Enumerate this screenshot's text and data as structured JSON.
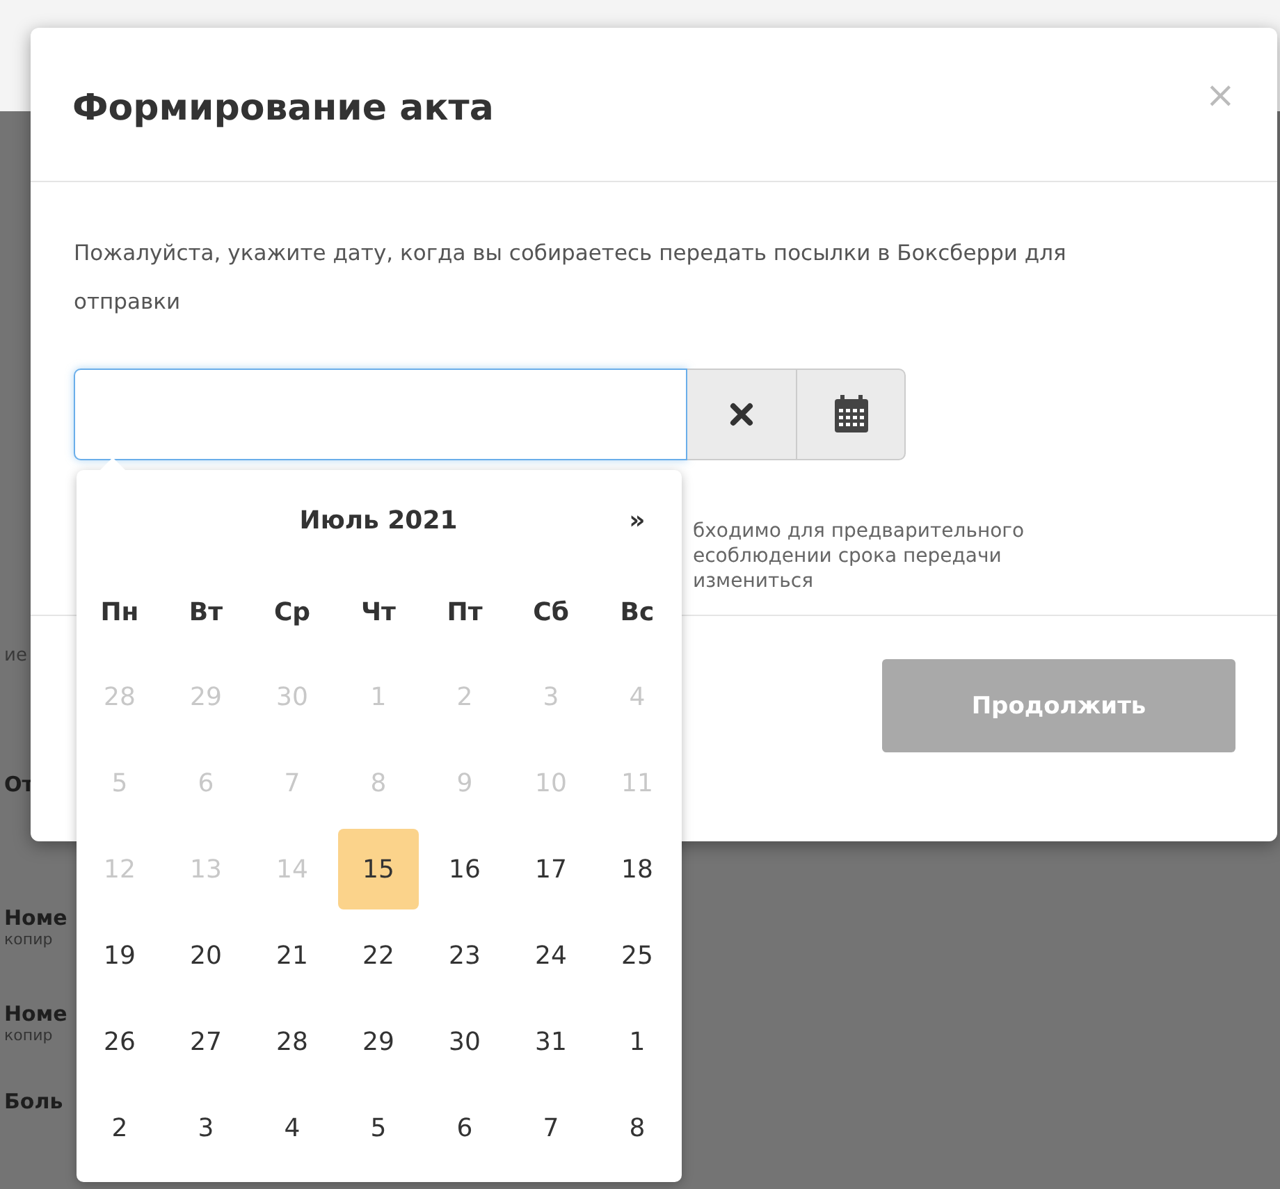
{
  "background_page": {
    "items": [
      {
        "kind": "small",
        "text": "ие"
      },
      {
        "kind": "bold",
        "text": "От"
      },
      {
        "kind": "bold",
        "text": "Номе"
      },
      {
        "kind": "small",
        "text": "копир"
      },
      {
        "kind": "bold",
        "text": "Номе"
      },
      {
        "kind": "small",
        "text": "копир"
      },
      {
        "kind": "bold",
        "text": "Боль"
      }
    ]
  },
  "dialog": {
    "title": "Формирование акта",
    "close": "×",
    "message": "Пожалуйста, укажите дату, когда вы собираетесь передать посылки в Боксберри для отправки",
    "note_lines": [
      "бходимо для предварительного",
      "есоблюдении срока передачи",
      "измениться"
    ],
    "continue_button": {
      "label": "Продолжить",
      "disabled": true
    }
  },
  "datepicker": {
    "month": "Июль 2021",
    "next": "»",
    "weekdays": [
      "Пн",
      "Вт",
      "Ср",
      "Чт",
      "Пт",
      "Сб",
      "Вс"
    ],
    "weeks": [
      [
        {
          "day": "28",
          "disabled": true,
          "selected": false
        },
        {
          "day": "29",
          "disabled": true,
          "selected": false
        },
        {
          "day": "30",
          "disabled": true,
          "selected": false
        },
        {
          "day": "1",
          "disabled": true,
          "selected": false
        },
        {
          "day": "2",
          "disabled": true,
          "selected": false
        },
        {
          "day": "3",
          "disabled": true,
          "selected": false
        },
        {
          "day": "4",
          "disabled": true,
          "selected": false
        }
      ],
      [
        {
          "day": "5",
          "disabled": true,
          "selected": false
        },
        {
          "day": "6",
          "disabled": true,
          "selected": false
        },
        {
          "day": "7",
          "disabled": true,
          "selected": false
        },
        {
          "day": "8",
          "disabled": true,
          "selected": false
        },
        {
          "day": "9",
          "disabled": true,
          "selected": false
        },
        {
          "day": "10",
          "disabled": true,
          "selected": false
        },
        {
          "day": "11",
          "disabled": true,
          "selected": false
        }
      ],
      [
        {
          "day": "12",
          "disabled": true,
          "selected": false
        },
        {
          "day": "13",
          "disabled": true,
          "selected": false
        },
        {
          "day": "14",
          "disabled": true,
          "selected": false
        },
        {
          "day": "15",
          "disabled": false,
          "selected": true
        },
        {
          "day": "16",
          "disabled": false,
          "selected": false
        },
        {
          "day": "17",
          "disabled": false,
          "selected": false
        },
        {
          "day": "18",
          "disabled": false,
          "selected": false
        }
      ],
      [
        {
          "day": "19",
          "disabled": false,
          "selected": false
        },
        {
          "day": "20",
          "disabled": false,
          "selected": false
        },
        {
          "day": "21",
          "disabled": false,
          "selected": false
        },
        {
          "day": "22",
          "disabled": false,
          "selected": false
        },
        {
          "day": "23",
          "disabled": false,
          "selected": false
        },
        {
          "day": "24",
          "disabled": false,
          "selected": false
        },
        {
          "day": "25",
          "disabled": false,
          "selected": false
        }
      ],
      [
        {
          "day": "26",
          "disabled": false,
          "selected": false
        },
        {
          "day": "27",
          "disabled": false,
          "selected": false
        },
        {
          "day": "28",
          "disabled": false,
          "selected": false
        },
        {
          "day": "29",
          "disabled": false,
          "selected": false
        },
        {
          "day": "30",
          "disabled": false,
          "selected": false
        },
        {
          "day": "31",
          "disabled": false,
          "selected": false
        },
        {
          "day": "1",
          "disabled": false,
          "selected": false
        }
      ],
      [
        {
          "day": "2",
          "disabled": false,
          "selected": false
        },
        {
          "day": "3",
          "disabled": false,
          "selected": false
        },
        {
          "day": "4",
          "disabled": false,
          "selected": false
        },
        {
          "day": "5",
          "disabled": false,
          "selected": false
        },
        {
          "day": "6",
          "disabled": false,
          "selected": false
        },
        {
          "day": "7",
          "disabled": false,
          "selected": false
        },
        {
          "day": "8",
          "disabled": false,
          "selected": false
        }
      ]
    ]
  }
}
